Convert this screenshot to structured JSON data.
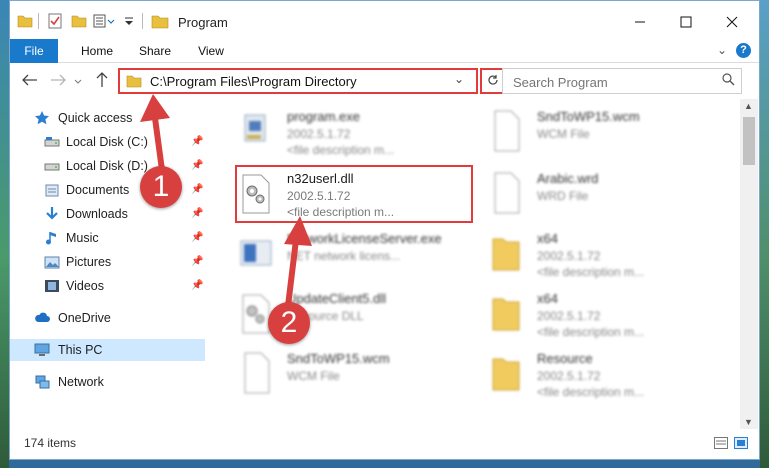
{
  "window": {
    "title": "Program",
    "min_icon": "minimize-icon",
    "max_icon": "maximize-icon",
    "close_icon": "close-icon"
  },
  "ribbon": {
    "tabs": [
      "File",
      "Home",
      "Share",
      "View"
    ],
    "help": "?"
  },
  "address": {
    "path": "C:\\Program Files\\Program Directory",
    "search_placeholder": "Search Program"
  },
  "nav": {
    "items": [
      {
        "label": "Quick access",
        "icon": "star-icon",
        "pinned": false
      },
      {
        "label": "Local Disk (C:)",
        "icon": "drive-icon",
        "pinned": true
      },
      {
        "label": "Local Disk (D:)",
        "icon": "drive-icon",
        "pinned": true
      },
      {
        "label": "Documents",
        "icon": "documents-icon",
        "pinned": true
      },
      {
        "label": "Downloads",
        "icon": "download-icon",
        "pinned": true
      },
      {
        "label": "Music",
        "icon": "music-icon",
        "pinned": true
      },
      {
        "label": "Pictures",
        "icon": "pictures-icon",
        "pinned": true
      },
      {
        "label": "Videos",
        "icon": "videos-icon",
        "pinned": true
      },
      {
        "label": "OneDrive",
        "icon": "cloud-icon",
        "pinned": false
      },
      {
        "label": "This PC",
        "icon": "computer-icon",
        "pinned": false,
        "selected": true
      },
      {
        "label": "Network",
        "icon": "network-icon",
        "pinned": false
      }
    ]
  },
  "files": [
    {
      "name": "program.exe",
      "line2": "2002.5.1.72",
      "line3": "<file description m...",
      "icon": "exe-icon",
      "blurred": true
    },
    {
      "name": "SndToWP15.wcm",
      "line2": "WCM File",
      "line3": "",
      "icon": "file-icon",
      "blurred": true
    },
    {
      "name": "n32userl.dll",
      "line2": "2002.5.1.72",
      "line3": "<file description m...",
      "icon": "dll-gear-icon",
      "blurred": false
    },
    {
      "name": "Arabic.wrd",
      "line2": "WRD File",
      "line3": "",
      "icon": "file-icon",
      "blurred": true
    },
    {
      "name": "NetworkLicenseServer.exe",
      "line2": "NET network licens...",
      "line3": "",
      "icon": "app-icon",
      "blurred": true
    },
    {
      "name": "x64",
      "line2": "2002.5.1.72",
      "line3": "<file description m...",
      "icon": "folder-icon",
      "blurred": true
    },
    {
      "name": "UpdateClient5.dll",
      "line2": "Resource DLL",
      "line3": "",
      "icon": "dll-gear-icon",
      "blurred": true
    },
    {
      "name": "x64",
      "line2": "2002.5.1.72",
      "line3": "<file description m...",
      "icon": "folder-icon",
      "blurred": true
    },
    {
      "name": "SndToWP15.wcm",
      "line2": "WCM File",
      "line3": "",
      "icon": "file-icon",
      "blurred": true
    },
    {
      "name": "Resource",
      "line2": "2002.5.1.72",
      "line3": "<file description m...",
      "icon": "folder-icon",
      "blurred": true
    }
  ],
  "status": {
    "item_count": "174 items"
  },
  "annotations": {
    "step1": "1",
    "step2": "2",
    "color": "#d8403f"
  }
}
